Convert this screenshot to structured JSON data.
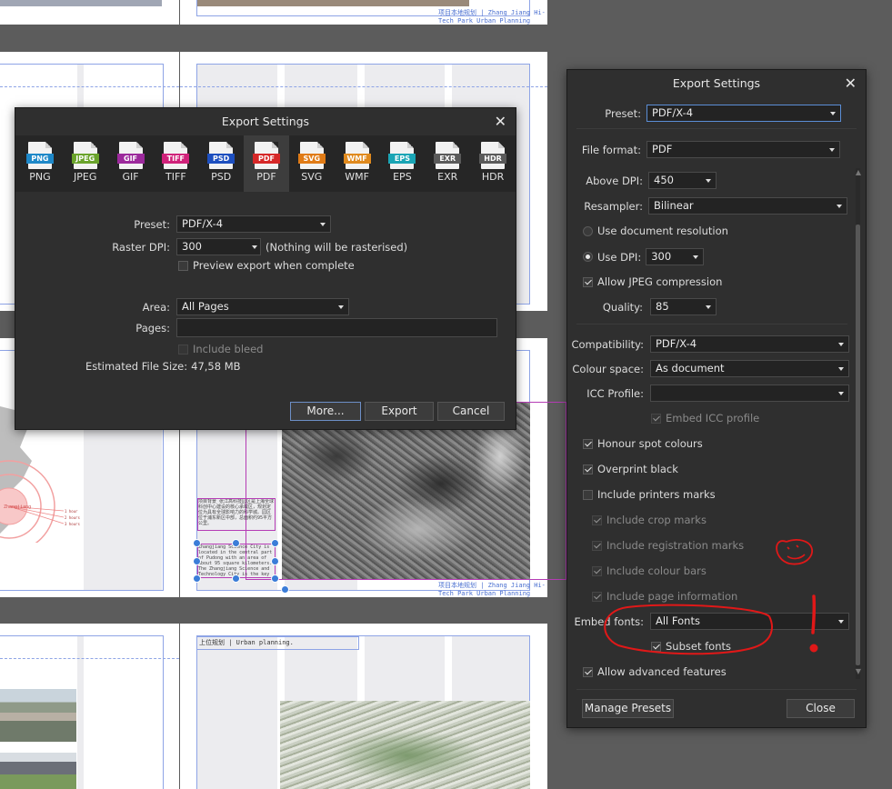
{
  "bg": {
    "captions": [
      "项目本地规划 | Zhang Jiang Hi-Tech Park Urban Planning",
      "项目本地规划 | Zhang Jiang Hi-Tech Park Urban Planning"
    ],
    "heading": "上位规划 | Urban planning.",
    "textblock_cn": "项目背景\n张江高科技园区是上海全球科创中心建设的核心承载区，规划定位为具有全球影响力的科学城。园区位于浦东新区中部，总面积约95平方公里。",
    "textblock_en": "Zhangjiang Science City is located in the central part of Pudong with an area of about 95 square kilometers. The Zhangjiang Science and Technology City is the key area for the construction of Shanghai's science and innovation center.",
    "map_labels": [
      "Zhangjiang",
      "1 hour",
      "2 hours",
      "3 hours"
    ]
  },
  "main_dialog": {
    "title": "Export Settings",
    "formats": [
      {
        "label": "PNG",
        "color": "#1e88c8"
      },
      {
        "label": "JPEG",
        "color": "#6aa32b"
      },
      {
        "label": "GIF",
        "color": "#9c2a9c"
      },
      {
        "label": "TIFF",
        "color": "#d0227a"
      },
      {
        "label": "PSD",
        "color": "#1d4fbf"
      },
      {
        "label": "PDF",
        "color": "#d62828",
        "active": true
      },
      {
        "label": "SVG",
        "color": "#e07b16"
      },
      {
        "label": "WMF",
        "color": "#e08a1e"
      },
      {
        "label": "EPS",
        "color": "#1aa5b5"
      },
      {
        "label": "EXR",
        "color": "#5a5a5a"
      },
      {
        "label": "HDR",
        "color": "#5a5a5a"
      }
    ],
    "preset_label": "Preset:",
    "preset_value": "PDF/X-4",
    "raster_label": "Raster DPI:",
    "raster_value": "300",
    "raster_note": "(Nothing will be rasterised)",
    "preview_label": "Preview export when complete",
    "area_label": "Area:",
    "area_value": "All Pages",
    "pages_label": "Pages:",
    "pages_value": "",
    "bleed_label": "Include bleed",
    "filesize_label": "Estimated File Size:",
    "filesize_value": "47,58 MB",
    "more_button": "More...",
    "export_button": "Export",
    "cancel_button": "Cancel"
  },
  "side_dialog": {
    "title": "Export Settings",
    "preset_label": "Preset:",
    "preset_value": "PDF/X-4",
    "file_format_label": "File format:",
    "file_format_value": "PDF",
    "above_dpi_label": "Above DPI:",
    "above_dpi_value": "450",
    "resampler_label": "Resampler:",
    "resampler_value": "Bilinear",
    "use_doc_res_label": "Use document resolution",
    "use_dpi_label": "Use DPI:",
    "use_dpi_value": "300",
    "allow_jpeg_label": "Allow JPEG compression",
    "quality_label": "Quality:",
    "quality_value": "85",
    "compat_label": "Compatibility:",
    "compat_value": "PDF/X-4",
    "colour_space_label": "Colour space:",
    "colour_space_value": "As document",
    "icc_label": "ICC Profile:",
    "icc_value": "",
    "embed_icc_label": "Embed ICC profile",
    "honour_spot_label": "Honour spot colours",
    "overprint_label": "Overprint black",
    "printers_marks_label": "Include printers marks",
    "crop_marks_label": "Include crop marks",
    "reg_marks_label": "Include registration marks",
    "colour_bars_label": "Include colour bars",
    "page_info_label": "Include page information",
    "embed_fonts_label": "Embed fonts:",
    "embed_fonts_value": "All Fonts",
    "subset_fonts_label": "Subset fonts",
    "advanced_label": "Allow advanced features",
    "manage_presets_button": "Manage Presets",
    "close_button": "Close"
  },
  "annotation": {
    "color": "#e01818"
  }
}
